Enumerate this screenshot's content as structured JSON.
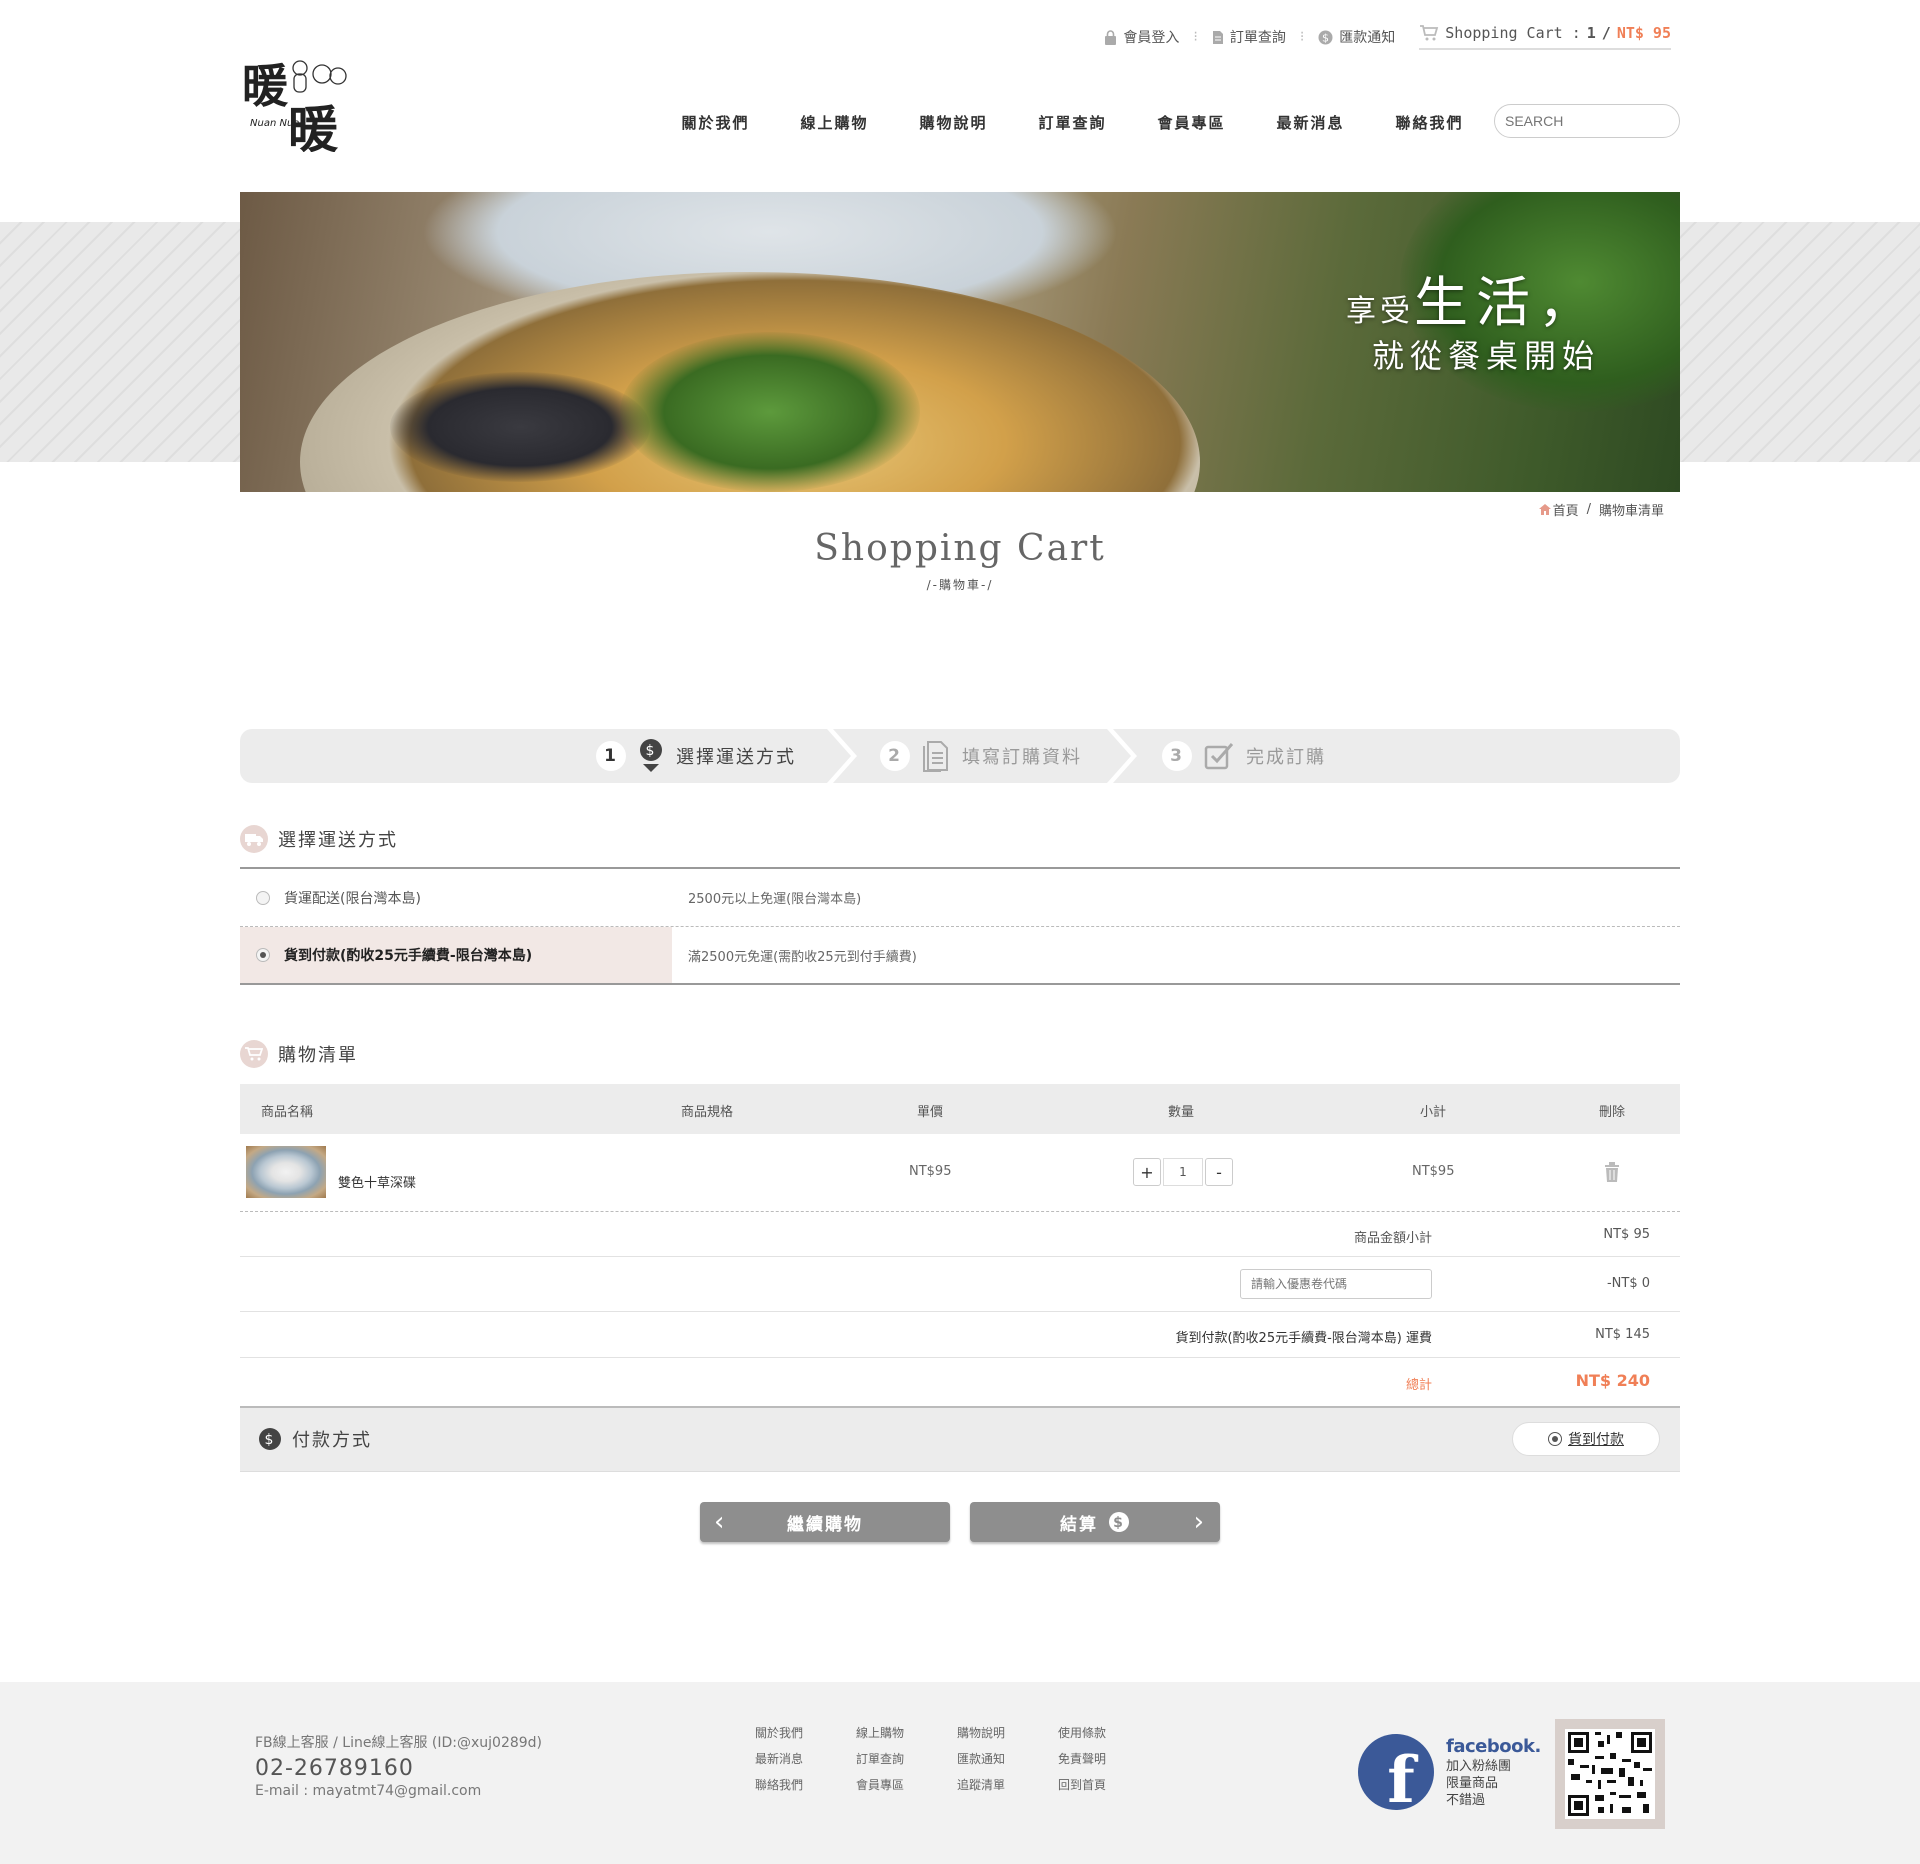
{
  "topbar": {
    "login": "會員登入",
    "order_query": "訂單查詢",
    "remit": "匯款通知",
    "cart_label": "Shopping Cart :",
    "cart_count": "1",
    "cart_sep": "/",
    "cart_amount": "NT$ 95"
  },
  "logo": {
    "text": "暖暖",
    "sub": "Nuan Nuan"
  },
  "nav": [
    "關於我們",
    "線上購物",
    "購物說明",
    "訂單查詢",
    "會員專區",
    "最新消息",
    "聯絡我們"
  ],
  "search": {
    "placeholder": "SEARCH"
  },
  "banner": {
    "line1_small": "享受",
    "line1_big": "生活，",
    "line2": "就從餐桌開始"
  },
  "breadcrumb": {
    "home": "首頁",
    "sep": "/",
    "current": "購物車清單"
  },
  "page": {
    "title": "Shopping Cart",
    "subtitle": "/-購物車-/"
  },
  "steps": [
    {
      "num": "1",
      "label": "選擇運送方式",
      "active": true
    },
    {
      "num": "2",
      "label": "填寫訂購資料",
      "active": false
    },
    {
      "num": "3",
      "label": "完成訂購",
      "active": false
    }
  ],
  "shipping": {
    "title": "選擇運送方式",
    "options": [
      {
        "label": "貨運配送(限台灣本島)",
        "desc": "2500元以上免運(限台灣本島)",
        "selected": false
      },
      {
        "label": "貨到付款(酌收25元手續費-限台灣本島)",
        "desc": "滿2500元免運(需酌收25元到付手續費)",
        "selected": true
      }
    ]
  },
  "cart": {
    "title": "購物清單",
    "headers": [
      "商品名稱",
      "商品規格",
      "單價",
      "數量",
      "小計",
      "刪除"
    ],
    "items": [
      {
        "name": "雙色十草深碟",
        "spec": "",
        "price": "NT$95",
        "qty": "1",
        "subtotal": "NT$95"
      }
    ],
    "qty_plus": "+",
    "qty_minus": "-",
    "summary": {
      "subtotal_label": "商品金額小計",
      "subtotal_value": "NT$ 95",
      "coupon_placeholder": "請輸入優惠卷代碼",
      "coupon_value": "-NT$ 0",
      "shipping_label": "貨到付款(酌收25元手續費-限台灣本島) 運費",
      "shipping_value": "NT$ 145",
      "total_label": "總計",
      "total_value": "NT$ 240"
    }
  },
  "payment": {
    "title": "付款方式",
    "option": "貨到付款"
  },
  "buttons": {
    "continue": "繼續購物",
    "checkout": "結算"
  },
  "footer": {
    "service": "FB線上客服 / Line線上客服 (ID:@xuj0289d)",
    "phone": "02-26789160",
    "email": "E-mail : mayatmt74@gmail.com",
    "links": [
      "關於我們",
      "線上購物",
      "購物說明",
      "使用條款",
      "最新消息",
      "訂單查詢",
      "匯款通知",
      "免責聲明",
      "聯絡我們",
      "會員專區",
      "追蹤清單",
      "回到首頁"
    ],
    "fb_brand": "facebook.",
    "fb_lines": [
      "加入粉絲團",
      "限量商品",
      "不錯過"
    ]
  },
  "colors": {
    "accent": "#f07f56",
    "panel": "#ececec",
    "selected_row": "#f2e8e5",
    "button": "#8e8e8e",
    "facebook": "#3b5998"
  }
}
